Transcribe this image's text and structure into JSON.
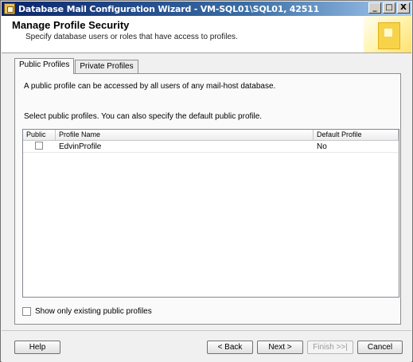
{
  "window": {
    "title": "Database Mail Configuration Wizard - VM-SQL01\\SQL01, 42511",
    "min_glyph": "_",
    "max_glyph": "□",
    "close_glyph": "X"
  },
  "header": {
    "title": "Manage Profile Security",
    "subtitle": "Specify database users or roles that have access to profiles."
  },
  "tabs": [
    {
      "label": "Public Profiles",
      "active": true
    },
    {
      "label": "Private Profiles",
      "active": false
    }
  ],
  "panel": {
    "description": "A public profile can be accessed by all users of any mail-host database.",
    "instruction": "Select public profiles. You can also specify the default public profile."
  },
  "grid": {
    "columns": [
      "Public",
      "Profile Name",
      "Default Profile"
    ],
    "rows": [
      {
        "public": false,
        "profile_name": "EdvinProfile",
        "default_profile": "No"
      }
    ]
  },
  "show_only": {
    "label": "Show only existing public profiles",
    "checked": false
  },
  "buttons": {
    "help": "Help",
    "back": "< Back",
    "next": "Next >",
    "finish": "Finish >>|",
    "cancel": "Cancel"
  }
}
